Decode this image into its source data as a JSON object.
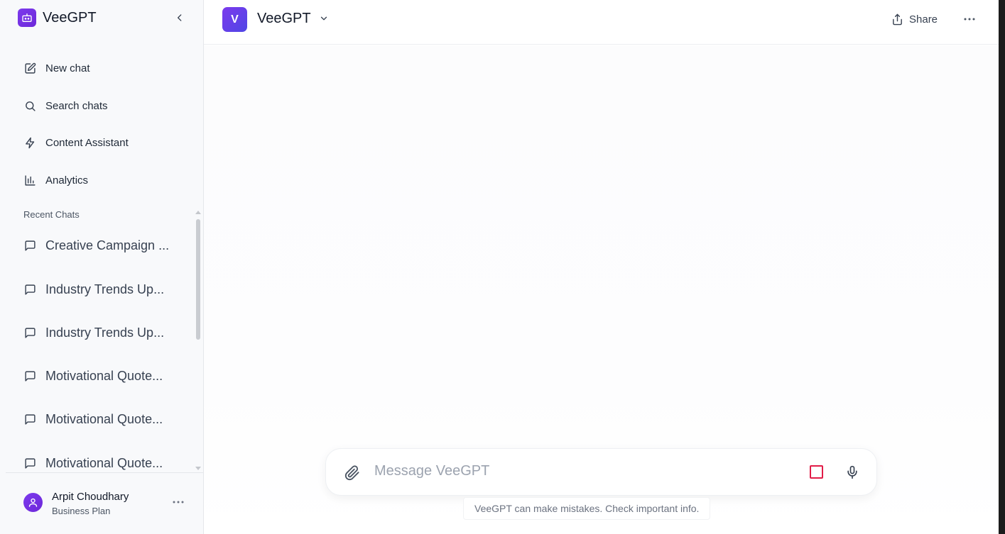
{
  "app": {
    "name": "VeeGPT"
  },
  "sidebar": {
    "nav": [
      {
        "label": "New chat",
        "icon": "edit-icon"
      },
      {
        "label": "Search chats",
        "icon": "search-icon"
      },
      {
        "label": "Content Assistant",
        "icon": "bolt-icon"
      },
      {
        "label": "Analytics",
        "icon": "bar-chart-icon"
      }
    ],
    "recent_title": "Recent Chats",
    "recent_chats": [
      {
        "label": "Creative Campaign ..."
      },
      {
        "label": "Industry Trends Up..."
      },
      {
        "label": "Industry Trends Up..."
      },
      {
        "label": "Motivational Quote..."
      },
      {
        "label": "Motivational Quote..."
      },
      {
        "label": "Motivational Quote..."
      }
    ],
    "user": {
      "name": "Arpit Choudhary",
      "plan": "Business Plan"
    }
  },
  "header": {
    "model_initial": "V",
    "model_name": "VeeGPT",
    "share_label": "Share"
  },
  "composer": {
    "placeholder": "Message VeeGPT",
    "value": ""
  },
  "disclaimer": "VeeGPT can make mistakes. Check important info.",
  "colors": {
    "accent": "#7c3aed",
    "stop": "#e11d48"
  }
}
